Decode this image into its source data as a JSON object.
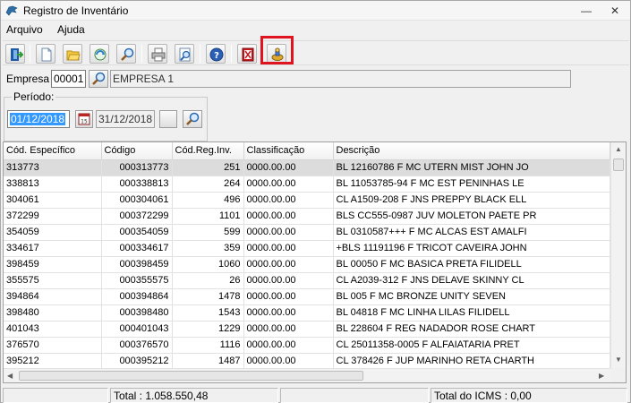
{
  "window": {
    "title": "Registro de Inventário",
    "min_glyph": "—",
    "close_glyph": "✕"
  },
  "menu": [
    "Arquivo",
    "Ajuda"
  ],
  "toolbar": {
    "icons": [
      "exit-icon",
      "new-document-icon",
      "open-folder-icon",
      "refresh-icon",
      "search-icon",
      "print-icon",
      "print-preview-icon",
      "help-icon",
      "export-pdf-icon",
      "process-icon"
    ],
    "highlight_color": "#e0141e"
  },
  "empresa": {
    "label": "Empresa",
    "code": "00001",
    "name": "EMPRESA 1"
  },
  "periodo": {
    "label": "Período:",
    "start": "01/12/2018",
    "end": "31/12/2018",
    "calendar_glyph": "15"
  },
  "grid": {
    "columns": [
      "Cód. Específico",
      "Código",
      "Cód.Reg.Inv.",
      "Classificação",
      "Descrição"
    ],
    "rows": [
      [
        "313773",
        "000313773",
        "251",
        "0000.00.00",
        "BL 12160786 F MC UTERN MIST JOHN JO"
      ],
      [
        "338813",
        "000338813",
        "264",
        "0000.00.00",
        "BL 11053785-94 F MC EST PENINHAS LE"
      ],
      [
        "304061",
        "000304061",
        "496",
        "0000.00.00",
        "CL A1509-208 F JNS PREPPY BLACK ELL"
      ],
      [
        "372299",
        "000372299",
        "1101",
        "0000.00.00",
        "BLS CC555-0987 JUV MOLETON PAETE PR"
      ],
      [
        "354059",
        "000354059",
        "599",
        "0000.00.00",
        "BL 0310587+++ F MC ALCAS EST AMALFI"
      ],
      [
        "334617",
        "000334617",
        "359",
        "0000.00.00",
        "+BLS 11191196 F TRICOT CAVEIRA JOHN"
      ],
      [
        "398459",
        "000398459",
        "1060",
        "0000.00.00",
        "BL 00050 F MC BASICA PRETA FILIDELL"
      ],
      [
        "355575",
        "000355575",
        "26",
        "0000.00.00",
        "CL A2039-312 F JNS DELAVE SKINNY CL"
      ],
      [
        "394864",
        "000394864",
        "1478",
        "0000.00.00",
        "BL 005 F MC BRONZE UNITY SEVEN"
      ],
      [
        "398480",
        "000398480",
        "1543",
        "0000.00.00",
        "BL 04818 F MC LINHA LILAS FILIDELL"
      ],
      [
        "401043",
        "000401043",
        "1229",
        "0000.00.00",
        "BL 228604 F REG NADADOR ROSE CHART"
      ],
      [
        "376570",
        "000376570",
        "1116",
        "0000.00.00",
        "CL 25011358-0005 F ALFAIATARIA PRET"
      ],
      [
        "395212",
        "000395212",
        "1487",
        "0000.00.00",
        "CL 378426 F JUP MARINHO RETA CHARTH"
      ]
    ]
  },
  "status": {
    "total": "Total : 1.058.550,48",
    "total_icms": "Total do ICMS : 0,00"
  }
}
